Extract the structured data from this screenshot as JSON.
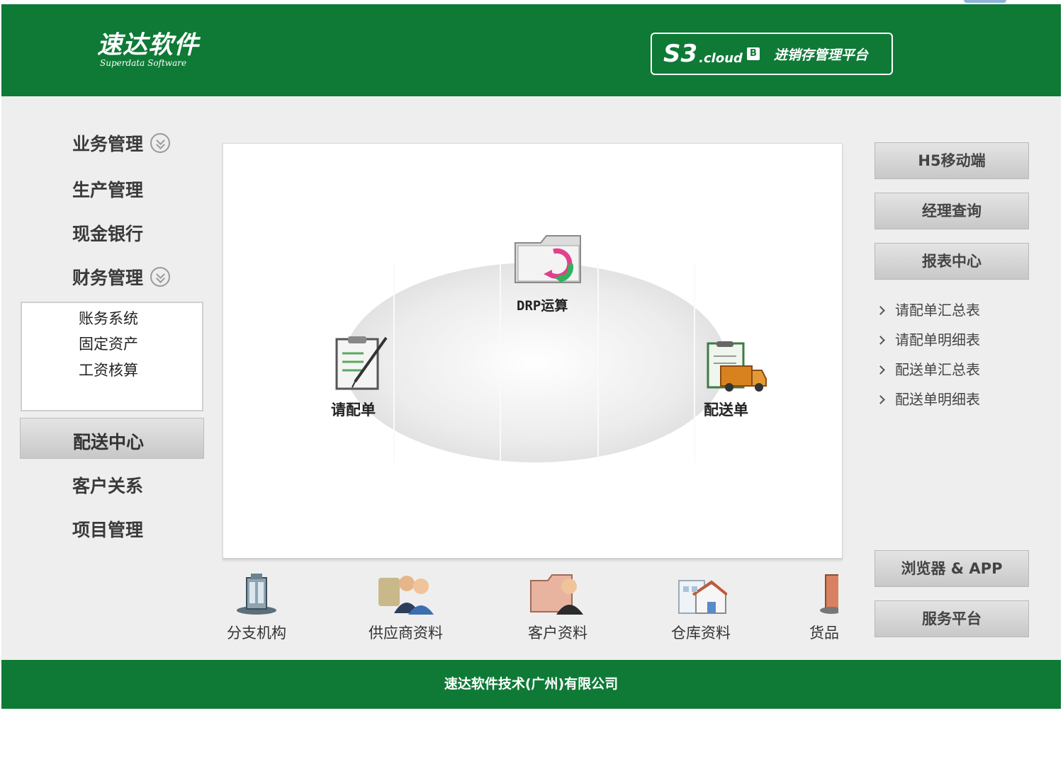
{
  "header": {
    "logo_main": "速达软件",
    "logo_sub": "Superdata Software",
    "product_brand": "S3",
    "product_cloud": ".cloud",
    "product_mark": "B",
    "product_title": "进销存管理平台"
  },
  "sidebar": {
    "items": [
      {
        "label": "业务管理",
        "expandable": true
      },
      {
        "label": "生产管理"
      },
      {
        "label": "现金银行"
      },
      {
        "label": "财务管理",
        "expandable": true
      },
      {
        "label": "配送中心",
        "active": true
      },
      {
        "label": "客户关系"
      },
      {
        "label": "项目管理"
      }
    ],
    "finance_sub": [
      "账务系统",
      "固定资产",
      "工资核算"
    ]
  },
  "canvas": {
    "nodes": {
      "drp": "DRP运算",
      "request": "请配单",
      "delivery": "配送单"
    }
  },
  "quick_links": [
    "分支机构",
    "供应商资料",
    "客户资料",
    "仓库资料",
    "货品"
  ],
  "right_panel": {
    "buttons_top": [
      "H5移动端",
      "经理查询",
      "报表中心"
    ],
    "reports": [
      "请配单汇总表",
      "请配单明细表",
      "配送单汇总表",
      "配送单明细表"
    ],
    "buttons_bottom": [
      "浏览器 & APP",
      "服务平台"
    ]
  },
  "footer": {
    "company": "速达软件技术(广州)有限公司"
  },
  "colors": {
    "brand_green": "#0e7a36",
    "panel_gray": "#eeeeee"
  }
}
